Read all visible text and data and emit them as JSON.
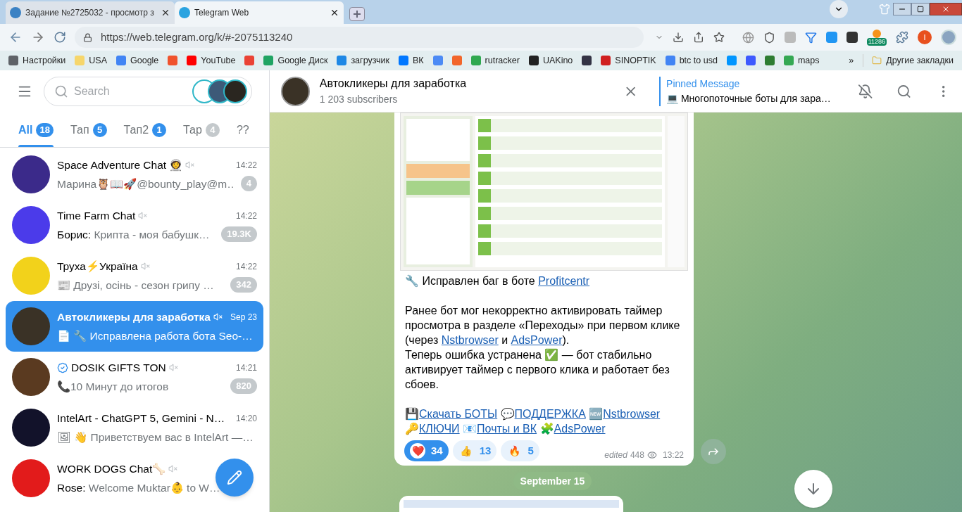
{
  "browser": {
    "tabs": [
      {
        "title": "Задание №2725032 - просмотр з",
        "selected": false,
        "color": "#3b82c4"
      },
      {
        "title": "Telegram Web",
        "selected": true,
        "color": "#2aa3e0"
      }
    ],
    "url": "https://web.telegram.org/k/#-2075113240",
    "extension_badge": "11286",
    "profile_letter": "I",
    "bookmarks": [
      {
        "label": "Настройки",
        "color": "#5f6368"
      },
      {
        "label": "USA",
        "color": "#f6d66b"
      },
      {
        "label": "Google",
        "color": "#4285f4"
      },
      {
        "color": "#f0532d"
      },
      {
        "label": "YouTube",
        "color": "#ff0000"
      },
      {
        "color": "#ea4335"
      },
      {
        "label": "Google Диск",
        "color": "#1fa463"
      },
      {
        "label": "загрузчик",
        "color": "#1e88e5"
      },
      {
        "label": "ВК",
        "color": "#0077ff"
      },
      {
        "color": "#4c8bf5"
      },
      {
        "color": "#f2662b"
      },
      {
        "label": "rutracker",
        "color": "#2fa84f"
      },
      {
        "label": "UAKino",
        "color": "#222222"
      },
      {
        "color": "#333344"
      },
      {
        "label": "SINOPTIK",
        "color": "#d02020"
      },
      {
        "label": "btc to usd",
        "color": "#4285f4"
      },
      {
        "color": "#0096ff"
      },
      {
        "color": "#3d5afe"
      },
      {
        "color": "#2e7d32"
      },
      {
        "label": "maps",
        "color": "#34a853"
      }
    ],
    "more": "»",
    "other": "Другие закладки"
  },
  "sidebar": {
    "search": {
      "placeholder": "Search"
    },
    "folders": [
      {
        "label": "All",
        "badge": "18",
        "selected": true,
        "muted": false
      },
      {
        "label": "Тап",
        "badge": "5",
        "selected": false,
        "muted": false
      },
      {
        "label": "Тап2",
        "badge": "1",
        "selected": false,
        "muted": false
      },
      {
        "label": "Тар",
        "badge": "4",
        "selected": false,
        "muted": true
      },
      {
        "label": "??",
        "selected": false
      }
    ],
    "chats": [
      {
        "name": "Space Adventure Chat 👩‍🚀",
        "muted": true,
        "verified": false,
        "time": "14:22",
        "preview": "Марина🦉📖🚀@bounty_play@m…",
        "badge": "4",
        "selected": false,
        "color": "#3b2a8a"
      },
      {
        "name": "Time Farm Chat",
        "muted": true,
        "verified": false,
        "time": "14:22",
        "sender": "Борис: ",
        "preview": "Крипта - моя бабушк…",
        "badge": "19.3K",
        "selected": false,
        "color": "#4b3bea"
      },
      {
        "name": "Труха⚡Україна",
        "muted": true,
        "verified": false,
        "time": "14:22",
        "preview": "📰 Друзі, осінь - сезон грипу …",
        "badge": "342",
        "selected": false,
        "color": "#f2d21b"
      },
      {
        "name": "Автокликеры для заработка",
        "muted": true,
        "verified": false,
        "time": "Sep 23",
        "preview": "📄 🔧 Исправлена работа бота Seo-…",
        "selected": true,
        "color": "#3a3226"
      },
      {
        "name": "DOSIK GIFTS TON",
        "muted": true,
        "verified": true,
        "time": "14:21",
        "preview": "📞10 Минут до итогов",
        "badge": "820",
        "selected": false,
        "color": "#5a3a20"
      },
      {
        "name": "IntelArt - ChatGPT 5, Gemini - N…",
        "muted": false,
        "verified": false,
        "time": "14:20",
        "preview": "🖼 👋 Приветствуем вас в IntelArt —…",
        "selected": false,
        "color": "#12122a"
      },
      {
        "name": "WORK DOGS Chat🦴",
        "muted": true,
        "verified": false,
        "sender": "Rose: ",
        "preview": "Welcome Muktar👶 to W…",
        "selected": false,
        "color": "#e21b1b"
      }
    ]
  },
  "chat": {
    "title": "Автокликеры для заработка",
    "subtitle": "1 203 subscribers",
    "pinned": {
      "label": "Pinned Message",
      "text": "💻 Многопоточные боты для зара…"
    },
    "message": {
      "blocks": [
        [
          [
            {
              "text": "🔧 Исправлен баг в боте "
            },
            {
              "link": "Profitcentr"
            }
          ]
        ],
        [
          [
            {
              "text": "Ранее бот мог некорректно активировать таймер просмотра в разделе «Переходы» при первом клике (через "
            },
            {
              "link": "Nstbrowser"
            },
            {
              "text": " и "
            },
            {
              "link": "AdsPower"
            },
            {
              "text": ")."
            }
          ],
          [
            {
              "text": "Теперь ошибка устранена ✅ — бот стабильно активирует таймер с первого клика и работает без сбоев."
            }
          ]
        ],
        [
          [
            {
              "text": "💾"
            },
            {
              "link": "Скачать БОТЫ"
            },
            {
              "text": " 💬"
            },
            {
              "link": "ПОДДЕРЖКА"
            },
            {
              "text": " 🆕"
            },
            {
              "link": "Nstbrowser"
            }
          ],
          [
            {
              "text": "🔑"
            },
            {
              "link": "КЛЮЧИ"
            },
            {
              "text": " 📧"
            },
            {
              "link": "Почты и ВК"
            },
            {
              "text": " 🧩"
            },
            {
              "link": "AdsPower"
            }
          ]
        ]
      ],
      "reactions": [
        {
          "emoji": "❤️",
          "count": "34",
          "selected": true
        },
        {
          "emoji": "👍",
          "count": "13",
          "selected": false
        },
        {
          "emoji": "🔥",
          "count": "5",
          "selected": false
        }
      ],
      "edited": "edited",
      "views": "448",
      "time": "13:22"
    },
    "date": "September 15"
  }
}
